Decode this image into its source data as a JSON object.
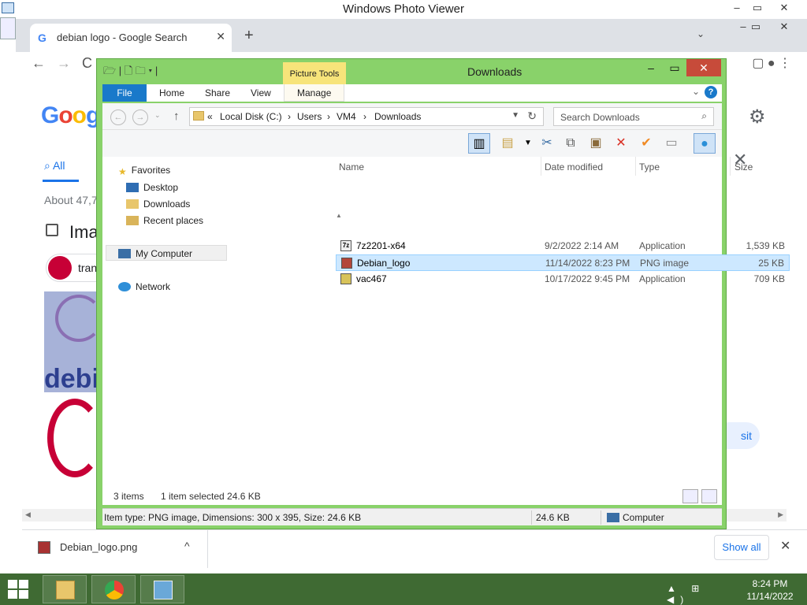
{
  "photo_viewer": {
    "title": "Windows Photo Viewer",
    "controls": [
      "–",
      "▭",
      "✕"
    ]
  },
  "chrome": {
    "tab_title": "debian logo - Google Search",
    "tab_close": "✕",
    "new_tab": "+",
    "nav_back": "←",
    "nav_forward": "→",
    "nav_reload": "C",
    "right_icons": "▢  ●  ⋮",
    "window_controls": [
      "–",
      "▭",
      "✕"
    ]
  },
  "google": {
    "logo_letters": [
      "G",
      "o",
      "o",
      "g"
    ],
    "tab_all": "All",
    "about": "About 47,7",
    "images_heading": "Ima",
    "chip_label": "tran",
    "debian_text": "debia",
    "visit": "sit"
  },
  "downloads": {
    "file_name": "Debian_logo.png",
    "chevron": "^",
    "show_all": "Show all",
    "close": "✕"
  },
  "explorer": {
    "title": "Downloads",
    "picture_tools": "Picture Tools",
    "ribbon_tabs": [
      "File",
      "Home",
      "Share",
      "View",
      "Manage"
    ],
    "address_crumbs": [
      "«",
      "Local Disk (C:)",
      "›",
      "Users",
      "›",
      "VM4",
      "›",
      "Downloads"
    ],
    "search_placeholder": "Search Downloads",
    "nav": {
      "favorites": "Favorites",
      "desktop": "Desktop",
      "downloads": "Downloads",
      "recent": "Recent places",
      "my_computer": "My Computer",
      "network": "Network"
    },
    "columns": {
      "name": "Name",
      "date": "Date modified",
      "type": "Type",
      "size": "Size"
    },
    "files": [
      {
        "name": "7z2201-x64",
        "date": "9/2/2022 2:14 AM",
        "type": "Application",
        "size": "1,539 KB",
        "icon": "7z"
      },
      {
        "name": "Debian_logo",
        "date": "11/14/2022 8:23 PM",
        "type": "PNG image",
        "size": "25 KB",
        "icon": "png"
      },
      {
        "name": "vac467",
        "date": "10/17/2022 9:45 PM",
        "type": "Application",
        "size": "709 KB",
        "icon": "app"
      }
    ],
    "status_items": "3 items",
    "status_selected": "1 item selected  24.6 KB",
    "details_text": "Item type: PNG image, Dimensions: 300 x 395, Size: 24.6 KB",
    "details_size": "24.6 KB",
    "details_location": "Computer"
  },
  "taskbar": {
    "time": "8:24 PM",
    "date": "11/14/2022",
    "tray_icons": "▲ ⊞ ◀)"
  },
  "colors": {
    "explorer_frame": "#89d26a",
    "taskbar": "#3f6a33",
    "file_tab": "#1979ca",
    "selection": "#cde8ff",
    "debian_red": "#c70036"
  }
}
